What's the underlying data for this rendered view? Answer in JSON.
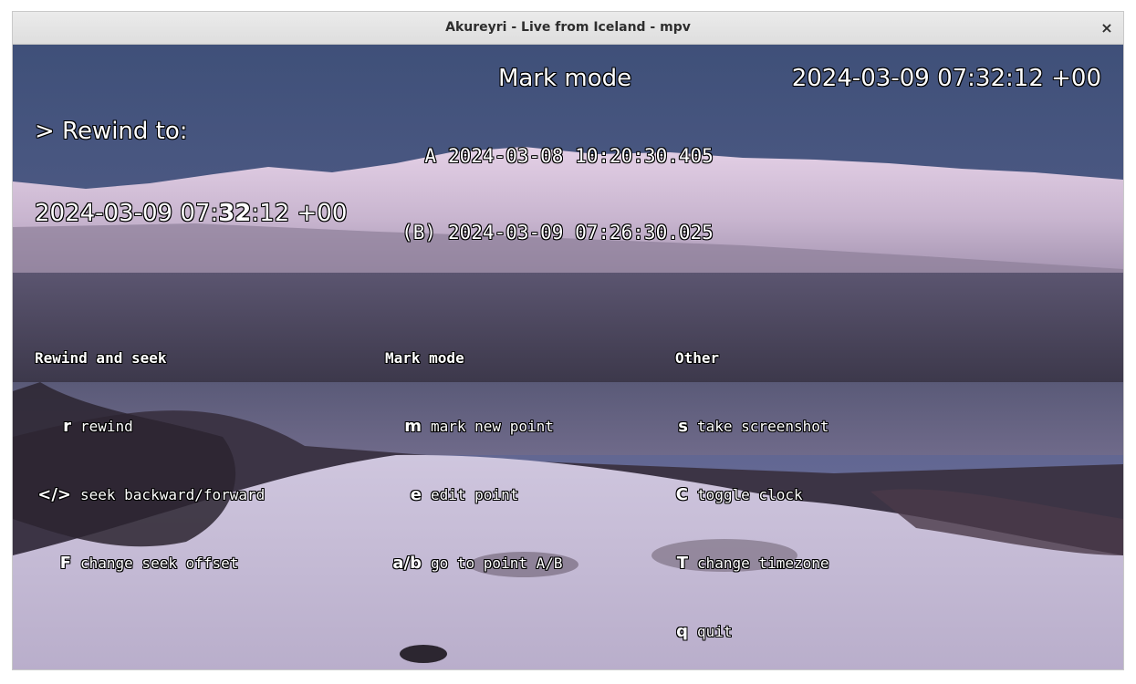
{
  "window": {
    "title": "Akureyri - Live from Iceland - mpv",
    "close_glyph": "×"
  },
  "osd": {
    "rewind": {
      "label": "> Rewind to:",
      "time_pre": "2024-03-09 07:",
      "time_emph": "32",
      "time_post": ":12 +00"
    },
    "mark_mode": {
      "title": "Mark mode",
      "a_label": "A",
      "a_value": "2024-03-08 10:20:30.405",
      "b_label": "(B)",
      "b_value": "2024-03-09 07:26:30.025"
    },
    "clock": "2024-03-09 07:32:12 +00"
  },
  "help": {
    "rewind_seek": {
      "header": "Rewind and seek",
      "items": [
        {
          "key": "r",
          "desc": "rewind"
        },
        {
          "key": "</>",
          "desc": "seek backward/forward"
        },
        {
          "key": "F",
          "desc": "change seek offset"
        }
      ]
    },
    "mark_mode": {
      "header": "Mark mode",
      "items": [
        {
          "key": "m",
          "desc": "mark new point"
        },
        {
          "key": "e",
          "desc": "edit point"
        },
        {
          "key": "a/b",
          "desc": "go to point A/B"
        }
      ]
    },
    "other": {
      "header": "Other",
      "items": [
        {
          "key": "s",
          "desc": "take screenshot"
        },
        {
          "key": "C",
          "desc": "toggle clock"
        },
        {
          "key": "T",
          "desc": "change timezone"
        },
        {
          "key": "q",
          "desc": "quit"
        }
      ]
    }
  }
}
